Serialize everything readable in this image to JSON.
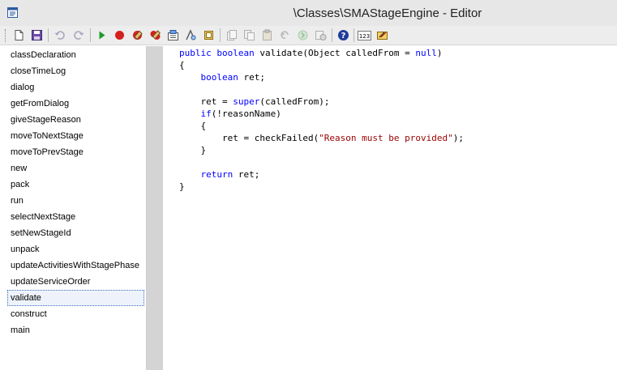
{
  "window": {
    "title": "\\Classes\\SMAStageEngine - Editor",
    "app_icon": "editor-window-icon"
  },
  "toolbar": {
    "icons": [
      "new-document-icon",
      "save-icon",
      "undo-icon",
      "redo-icon",
      "run-icon",
      "breakpoint-icon",
      "remove-breakpoint-icon",
      "remove-all-breakpoints-icon",
      "compile-icon",
      "find-icon",
      "lookup-icon",
      "open-icon",
      "copy-icon",
      "paste-icon",
      "back-icon",
      "forward-icon",
      "properties-icon",
      "help-icon",
      "line-number-icon",
      "script-icon"
    ],
    "line_number_label": "123"
  },
  "methods": {
    "items": [
      "classDeclaration",
      "closeTimeLog",
      "dialog",
      "getFromDialog",
      "giveStageReason",
      "moveToNextStage",
      "moveToPrevStage",
      "new",
      "pack",
      "run",
      "selectNextStage",
      "setNewStageId",
      "unpack",
      "updateActivitiesWithStagePhase",
      "updateServiceOrder",
      "validate",
      "construct",
      "main"
    ],
    "selected": "validate"
  },
  "code": {
    "lines": [
      [
        [
          "kw",
          "public boolean"
        ],
        [
          "",
          " validate(Object calledFrom = "
        ],
        [
          "kw",
          "null"
        ],
        [
          "",
          ")"
        ]
      ],
      [
        [
          "",
          "{"
        ]
      ],
      [
        [
          "",
          "    "
        ],
        [
          "kw",
          "boolean"
        ],
        [
          "",
          " ret;"
        ]
      ],
      [],
      [
        [
          "",
          "    ret = "
        ],
        [
          "kw",
          "super"
        ],
        [
          "",
          "(calledFrom);"
        ]
      ],
      [
        [
          "",
          "    "
        ],
        [
          "kw",
          "if"
        ],
        [
          "",
          "(!reasonName)"
        ]
      ],
      [
        [
          "",
          "    {"
        ]
      ],
      [
        [
          "",
          "        ret = checkFailed("
        ],
        [
          "str",
          "\"Reason must be provided\""
        ],
        [
          "",
          ");"
        ]
      ],
      [
        [
          "",
          "    }"
        ]
      ],
      [],
      [
        [
          "",
          "    "
        ],
        [
          "kw",
          "return"
        ],
        [
          "",
          " ret;"
        ]
      ],
      [
        [
          "",
          "}"
        ]
      ]
    ]
  },
  "colors": {
    "keyword": "#0000ff",
    "string": "#990000",
    "selection_border": "#3a6ec0",
    "splitter": "#d4d4d4"
  }
}
